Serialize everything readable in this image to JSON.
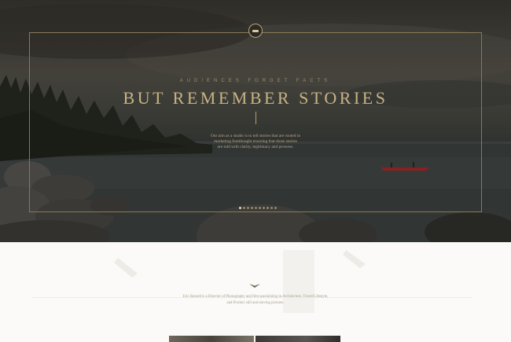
{
  "hero": {
    "eyebrow": "AUDIENCES FORGET FACTS",
    "headline": "BUT REMEMBER STORIES",
    "intro_lines": [
      "Our aim as a studio is to tell stories that are rooted in",
      "marketing forethought ensuring that those stories",
      "are told with clarity, legitimacy and prowess."
    ],
    "slides": {
      "count": 10,
      "active": 1
    }
  },
  "about": {
    "bio_lines": [
      "Eric Russell is a Director of Photography and film specializing in Architecture, Travel/Lifestyle,",
      "and Product still and moving pictures."
    ]
  },
  "colors": {
    "accent_gold": "#c8b384",
    "frame_gold": "#8a7a55",
    "canoe_red": "#b8262a",
    "page_bg": "#fbfaf8"
  },
  "icons": {
    "emblem": "logo-emblem-icon",
    "divider": "bird-divider-icon"
  }
}
